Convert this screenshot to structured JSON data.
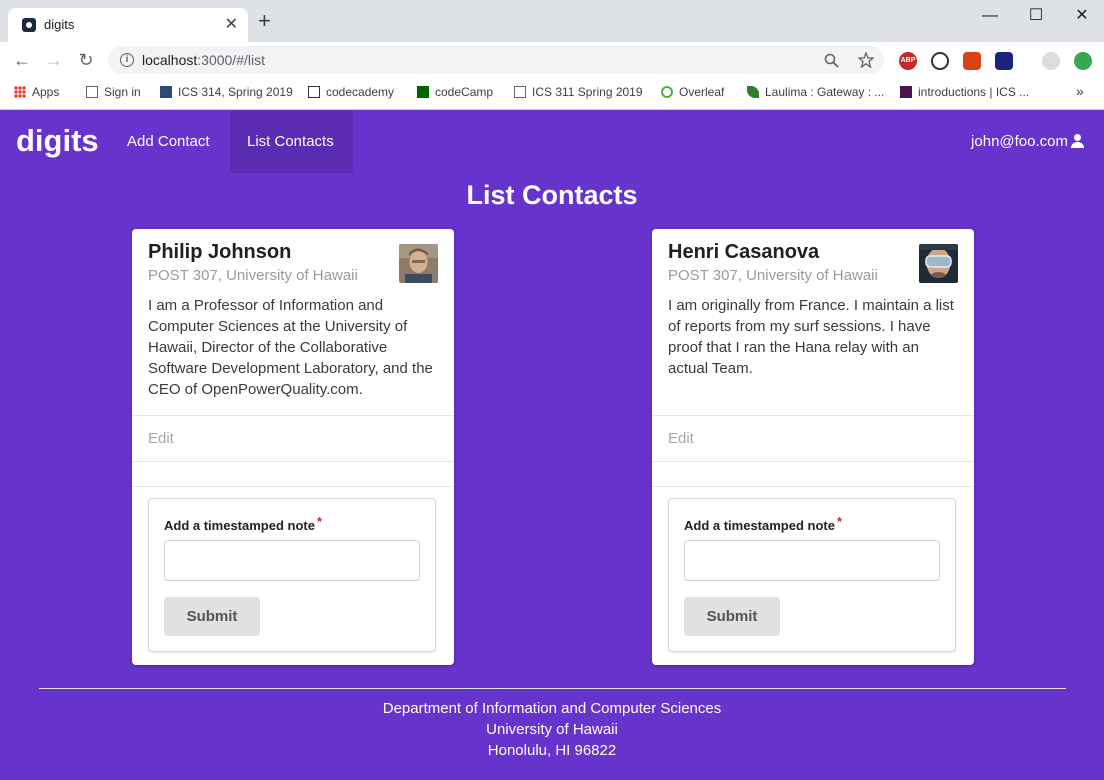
{
  "browser": {
    "tab_title": "digits",
    "tab_close": "✕",
    "new_tab": "+",
    "url_host": "localhost",
    "url_path": ":3000/#/list",
    "window_controls": {
      "minimize": "—",
      "maximize": "☐",
      "close": "✕"
    },
    "nav": {
      "back": "←",
      "forward": "→",
      "reload": "↻"
    }
  },
  "bookmarks": [
    {
      "label": "Apps",
      "icon": "apps-grid-icon"
    },
    {
      "label": "Sign in",
      "icon": "page-icon"
    },
    {
      "label": "ICS 314, Spring 2019",
      "icon": "square-icon"
    },
    {
      "label": "codecademy",
      "icon": "codecademy-icon"
    },
    {
      "label": "codeCamp",
      "icon": "codecamp-icon"
    },
    {
      "label": "ICS 311 Spring 2019",
      "icon": "page-icon"
    },
    {
      "label": "Overleaf",
      "icon": "overleaf-icon"
    },
    {
      "label": "Laulima : Gateway : ...",
      "icon": "leaf-icon"
    },
    {
      "label": "introductions | ICS ...",
      "icon": "slack-icon"
    }
  ],
  "bookmarks_more": "»",
  "navbar": {
    "brand": "digits",
    "add_contact": "Add Contact",
    "list_contacts": "List Contacts",
    "user": "john@foo.com"
  },
  "page": {
    "title": "List Contacts"
  },
  "contacts": [
    {
      "name": "Philip Johnson",
      "address": "POST 307, University of Hawaii",
      "description": "I am a Professor of Information and Computer Sciences at the University of Hawaii, Director of the Collaborative Software Development Laboratory, and the CEO of OpenPowerQuality.com.",
      "edit": "Edit",
      "note_label": "Add a timestamped note",
      "required": "*",
      "note_value": "",
      "submit": "Submit"
    },
    {
      "name": "Henri Casanova",
      "address": "POST 307, University of Hawaii",
      "description": "I am originally from France. I maintain a list of reports from my surf sessions. I have proof that I ran the Hana relay with an actual Team.",
      "edit": "Edit",
      "note_label": "Add a timestamped note",
      "required": "*",
      "note_value": "",
      "submit": "Submit"
    }
  ],
  "footer": {
    "line1": "Department of Information and Computer Sciences",
    "line2": "University of Hawaii",
    "line3": "Honolulu, HI 96822"
  },
  "colors": {
    "background": "#6633cc",
    "card": "#ffffff",
    "required": "#db2828"
  }
}
